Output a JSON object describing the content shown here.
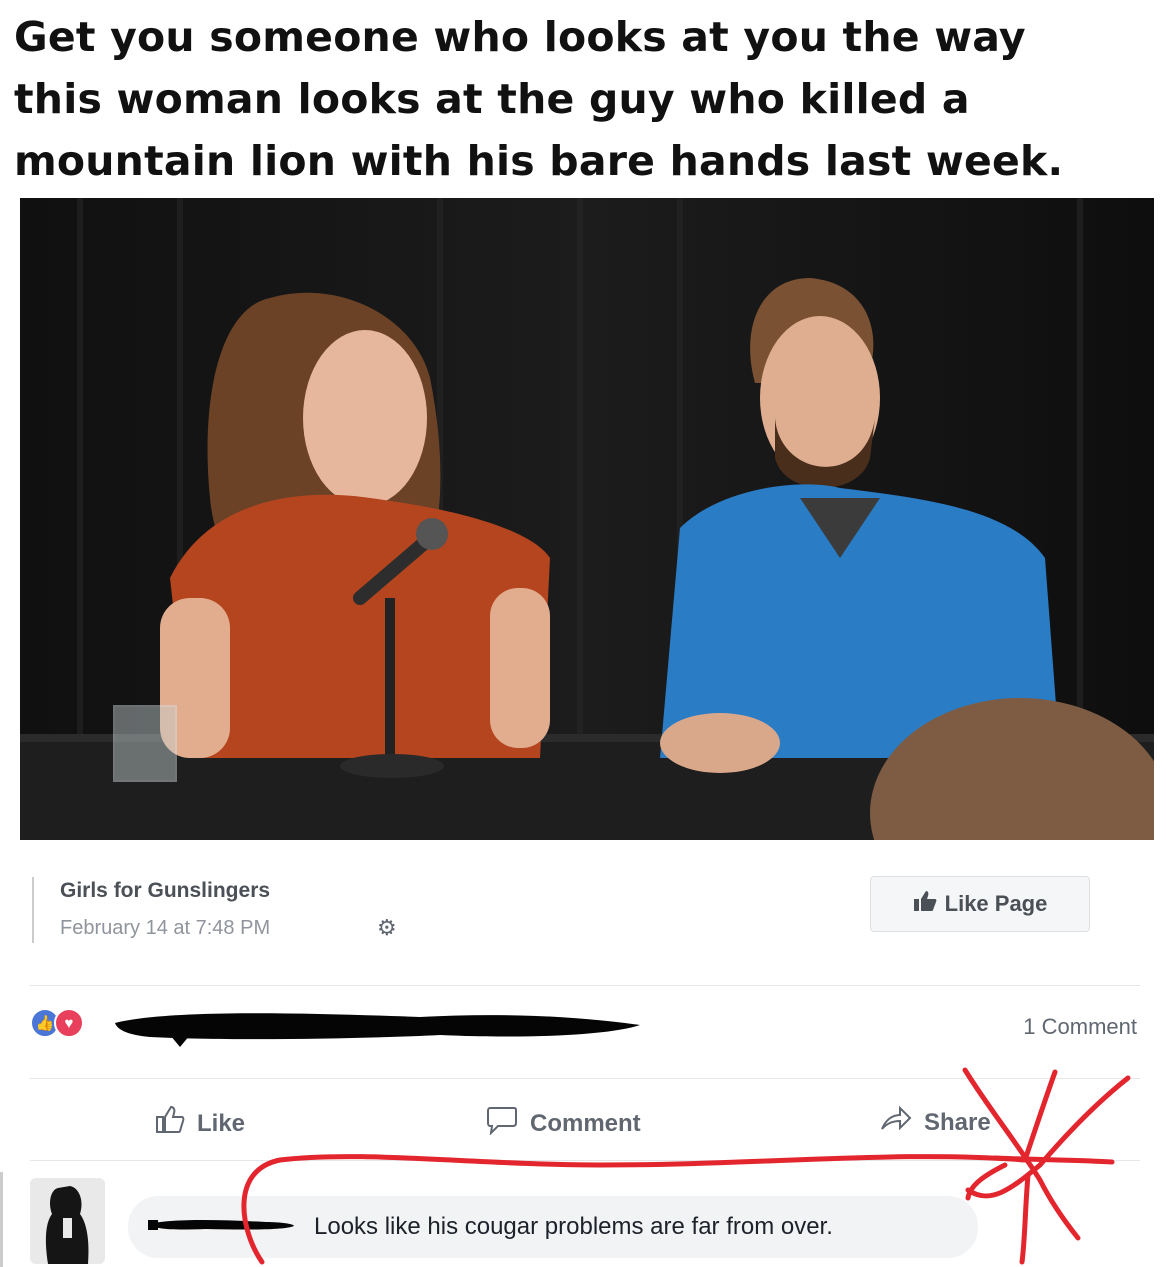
{
  "caption": {
    "line1": "Get you someone who looks at you the way",
    "line2": "this woman looks at the guy who killed a",
    "line3": "mountain lion with his bare hands last week."
  },
  "post": {
    "page_name": "Girls for Gunslingers",
    "date": "February 14 at 7:48 PM",
    "settings_icon": "gear-icon",
    "like_page_label": "Like Page",
    "comment_count": "1 Comment"
  },
  "actions": {
    "like_label": "Like",
    "comment_label": "Comment",
    "share_label": "Share"
  },
  "comment": {
    "text": "Looks like his cougar problems are far from over."
  },
  "colors": {
    "annotation_red": "#e3262e",
    "like_blue": "#4a76d8",
    "love_red": "#e8405c"
  }
}
